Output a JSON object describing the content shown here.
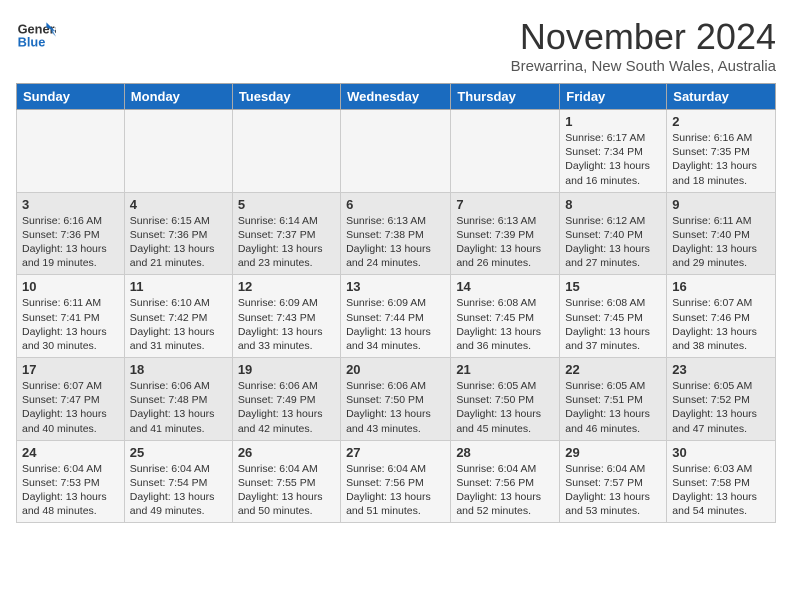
{
  "logo": {
    "line1": "General",
    "line2": "Blue"
  },
  "title": "November 2024",
  "location": "Brewarrina, New South Wales, Australia",
  "days_of_week": [
    "Sunday",
    "Monday",
    "Tuesday",
    "Wednesday",
    "Thursday",
    "Friday",
    "Saturday"
  ],
  "weeks": [
    [
      {
        "day": "",
        "info": ""
      },
      {
        "day": "",
        "info": ""
      },
      {
        "day": "",
        "info": ""
      },
      {
        "day": "",
        "info": ""
      },
      {
        "day": "",
        "info": ""
      },
      {
        "day": "1",
        "info": "Sunrise: 6:17 AM\nSunset: 7:34 PM\nDaylight: 13 hours and 16 minutes."
      },
      {
        "day": "2",
        "info": "Sunrise: 6:16 AM\nSunset: 7:35 PM\nDaylight: 13 hours and 18 minutes."
      }
    ],
    [
      {
        "day": "3",
        "info": "Sunrise: 6:16 AM\nSunset: 7:36 PM\nDaylight: 13 hours and 19 minutes."
      },
      {
        "day": "4",
        "info": "Sunrise: 6:15 AM\nSunset: 7:36 PM\nDaylight: 13 hours and 21 minutes."
      },
      {
        "day": "5",
        "info": "Sunrise: 6:14 AM\nSunset: 7:37 PM\nDaylight: 13 hours and 23 minutes."
      },
      {
        "day": "6",
        "info": "Sunrise: 6:13 AM\nSunset: 7:38 PM\nDaylight: 13 hours and 24 minutes."
      },
      {
        "day": "7",
        "info": "Sunrise: 6:13 AM\nSunset: 7:39 PM\nDaylight: 13 hours and 26 minutes."
      },
      {
        "day": "8",
        "info": "Sunrise: 6:12 AM\nSunset: 7:40 PM\nDaylight: 13 hours and 27 minutes."
      },
      {
        "day": "9",
        "info": "Sunrise: 6:11 AM\nSunset: 7:40 PM\nDaylight: 13 hours and 29 minutes."
      }
    ],
    [
      {
        "day": "10",
        "info": "Sunrise: 6:11 AM\nSunset: 7:41 PM\nDaylight: 13 hours and 30 minutes."
      },
      {
        "day": "11",
        "info": "Sunrise: 6:10 AM\nSunset: 7:42 PM\nDaylight: 13 hours and 31 minutes."
      },
      {
        "day": "12",
        "info": "Sunrise: 6:09 AM\nSunset: 7:43 PM\nDaylight: 13 hours and 33 minutes."
      },
      {
        "day": "13",
        "info": "Sunrise: 6:09 AM\nSunset: 7:44 PM\nDaylight: 13 hours and 34 minutes."
      },
      {
        "day": "14",
        "info": "Sunrise: 6:08 AM\nSunset: 7:45 PM\nDaylight: 13 hours and 36 minutes."
      },
      {
        "day": "15",
        "info": "Sunrise: 6:08 AM\nSunset: 7:45 PM\nDaylight: 13 hours and 37 minutes."
      },
      {
        "day": "16",
        "info": "Sunrise: 6:07 AM\nSunset: 7:46 PM\nDaylight: 13 hours and 38 minutes."
      }
    ],
    [
      {
        "day": "17",
        "info": "Sunrise: 6:07 AM\nSunset: 7:47 PM\nDaylight: 13 hours and 40 minutes."
      },
      {
        "day": "18",
        "info": "Sunrise: 6:06 AM\nSunset: 7:48 PM\nDaylight: 13 hours and 41 minutes."
      },
      {
        "day": "19",
        "info": "Sunrise: 6:06 AM\nSunset: 7:49 PM\nDaylight: 13 hours and 42 minutes."
      },
      {
        "day": "20",
        "info": "Sunrise: 6:06 AM\nSunset: 7:50 PM\nDaylight: 13 hours and 43 minutes."
      },
      {
        "day": "21",
        "info": "Sunrise: 6:05 AM\nSunset: 7:50 PM\nDaylight: 13 hours and 45 minutes."
      },
      {
        "day": "22",
        "info": "Sunrise: 6:05 AM\nSunset: 7:51 PM\nDaylight: 13 hours and 46 minutes."
      },
      {
        "day": "23",
        "info": "Sunrise: 6:05 AM\nSunset: 7:52 PM\nDaylight: 13 hours and 47 minutes."
      }
    ],
    [
      {
        "day": "24",
        "info": "Sunrise: 6:04 AM\nSunset: 7:53 PM\nDaylight: 13 hours and 48 minutes."
      },
      {
        "day": "25",
        "info": "Sunrise: 6:04 AM\nSunset: 7:54 PM\nDaylight: 13 hours and 49 minutes."
      },
      {
        "day": "26",
        "info": "Sunrise: 6:04 AM\nSunset: 7:55 PM\nDaylight: 13 hours and 50 minutes."
      },
      {
        "day": "27",
        "info": "Sunrise: 6:04 AM\nSunset: 7:56 PM\nDaylight: 13 hours and 51 minutes."
      },
      {
        "day": "28",
        "info": "Sunrise: 6:04 AM\nSunset: 7:56 PM\nDaylight: 13 hours and 52 minutes."
      },
      {
        "day": "29",
        "info": "Sunrise: 6:04 AM\nSunset: 7:57 PM\nDaylight: 13 hours and 53 minutes."
      },
      {
        "day": "30",
        "info": "Sunrise: 6:03 AM\nSunset: 7:58 PM\nDaylight: 13 hours and 54 minutes."
      }
    ]
  ]
}
